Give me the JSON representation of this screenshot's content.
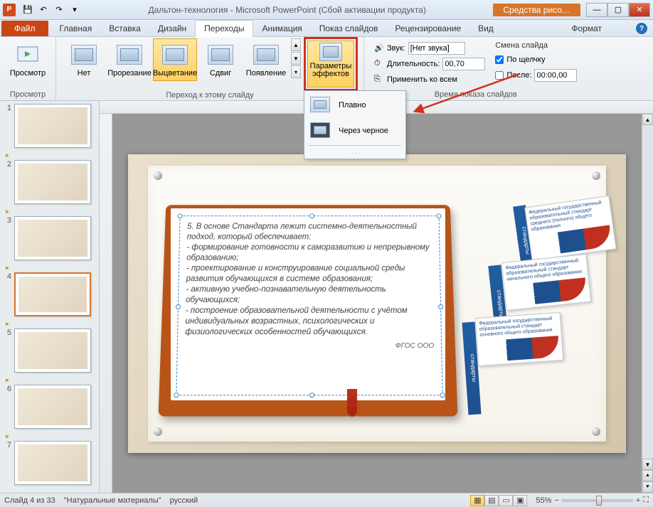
{
  "title": "Дальтон-технология - Microsoft PowerPoint (Сбой активации продукта)",
  "drawing_tools": "Средства рисо…",
  "tabs": {
    "file": "Файл",
    "home": "Главная",
    "insert": "Вставка",
    "design": "Дизайн",
    "transitions": "Переходы",
    "animations": "Анимация",
    "slideshow": "Показ слайдов",
    "review": "Рецензирование",
    "view": "Вид",
    "format": "Формат"
  },
  "ribbon": {
    "preview_group": "Просмотр",
    "preview": "Просмотр",
    "transition_group": "Переход к этому слайду",
    "trans": {
      "none": "Нет",
      "cut": "Прорезание",
      "fade": "Выцветание",
      "push": "Сдвиг",
      "wipe": "Появление"
    },
    "effect_options": "Параметры эффектов",
    "dd_smooth": "Плавно",
    "dd_black": "Через черное",
    "sound": "Звук:",
    "sound_value": "[Нет звука]",
    "duration": "Длительность:",
    "duration_value": "00,70",
    "apply_all": "Применить ко всем",
    "timing_group": "Время показа слайдов",
    "advance_title": "Смена слайда",
    "on_click": "По щелчку",
    "after": "После:",
    "after_value": "00:00,00"
  },
  "thumbs": [
    {
      "n": "1"
    },
    {
      "n": "2"
    },
    {
      "n": "3"
    },
    {
      "n": "4"
    },
    {
      "n": "5"
    },
    {
      "n": "6"
    },
    {
      "n": "7"
    }
  ],
  "book_text": "5. В основе Стандарта лежит системно-деятельностный подход, который обеспечивает:\n- формирование готовности к саморазвитию и непрерывному образованию;\n- проектирование и конструирование социальной среды развития обучающихся в системе образования;\n- активную учебно-познавательную деятельность обучающихся;\n- построение образовательной деятельности с учётом индивидуальных возрастных, психологических и физиологических особенностей обучающихся.",
  "book_foot": "ФГОС ООО",
  "doc_text1": "Федеральный государственный образовательный стандарт среднего (полного) общего образования",
  "doc_text2": "Федеральный государственный образовательный стандарт начального общего образования",
  "doc_text3": "Федеральный государственный образовательный стандарт основного общего образования",
  "doc_side": "стандарты",
  "status": {
    "slide": "Слайд 4 из 33",
    "theme": "\"Натуральные материалы\"",
    "lang": "русский",
    "zoom": "55%"
  }
}
